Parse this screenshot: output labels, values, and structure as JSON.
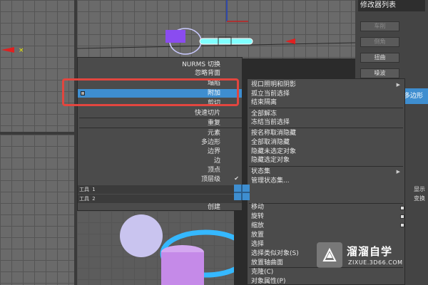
{
  "command_panel": {
    "modifier_list": "修改器列表",
    "buttons": [
      {
        "label": "车削",
        "dim": true
      },
      {
        "label": "倒角",
        "dim": true
      },
      {
        "label": "扭曲",
        "dim": false
      },
      {
        "label": "噪波",
        "dim": false
      }
    ],
    "tab": "多边形"
  },
  "quad_menu": {
    "top_items": [
      "NURMS 切换",
      "忽略背面",
      "塌陷",
      "附加",
      "剪切",
      "快速切片",
      "重复"
    ],
    "selected_item": "附加",
    "subobject_items": [
      "元素",
      "多边形",
      "边界",
      "边",
      "顶点",
      "顶层级"
    ],
    "checked_item": "顶层级",
    "titles": [
      "工具 1",
      "工具 2"
    ],
    "create_item": "创建"
  },
  "right_menu": {
    "group1": [
      {
        "label": "视口照明和阴影",
        "submenu": true
      },
      {
        "label": "孤立当前选择",
        "submenu": false
      },
      {
        "label": "结束隔离",
        "submenu": false
      }
    ],
    "group2": [
      "全部解冻",
      "冻结当前选择"
    ],
    "group3": [
      "按名称取消隐藏",
      "全部取消隐藏",
      "隐藏未选定对象",
      "隐藏选定对象"
    ],
    "group4": [
      {
        "label": "状态集",
        "submenu": true
      },
      {
        "label": "管理状态集...",
        "submenu": false
      }
    ],
    "labels": [
      "显示",
      "变换"
    ],
    "group5": [
      "移动",
      "旋转",
      "缩放",
      "放置",
      "选择",
      "选择类似对象(S)",
      "放置轴曲面",
      "克隆(C)",
      "对象属性(P)"
    ]
  },
  "watermark": {
    "name": "溜溜自学",
    "url": "ZIXUE.3D66.COM"
  },
  "colors": {
    "selection": "#3e8ed0",
    "highlight_box": "#e2463f",
    "menu_bg": "#4b4b4b"
  }
}
